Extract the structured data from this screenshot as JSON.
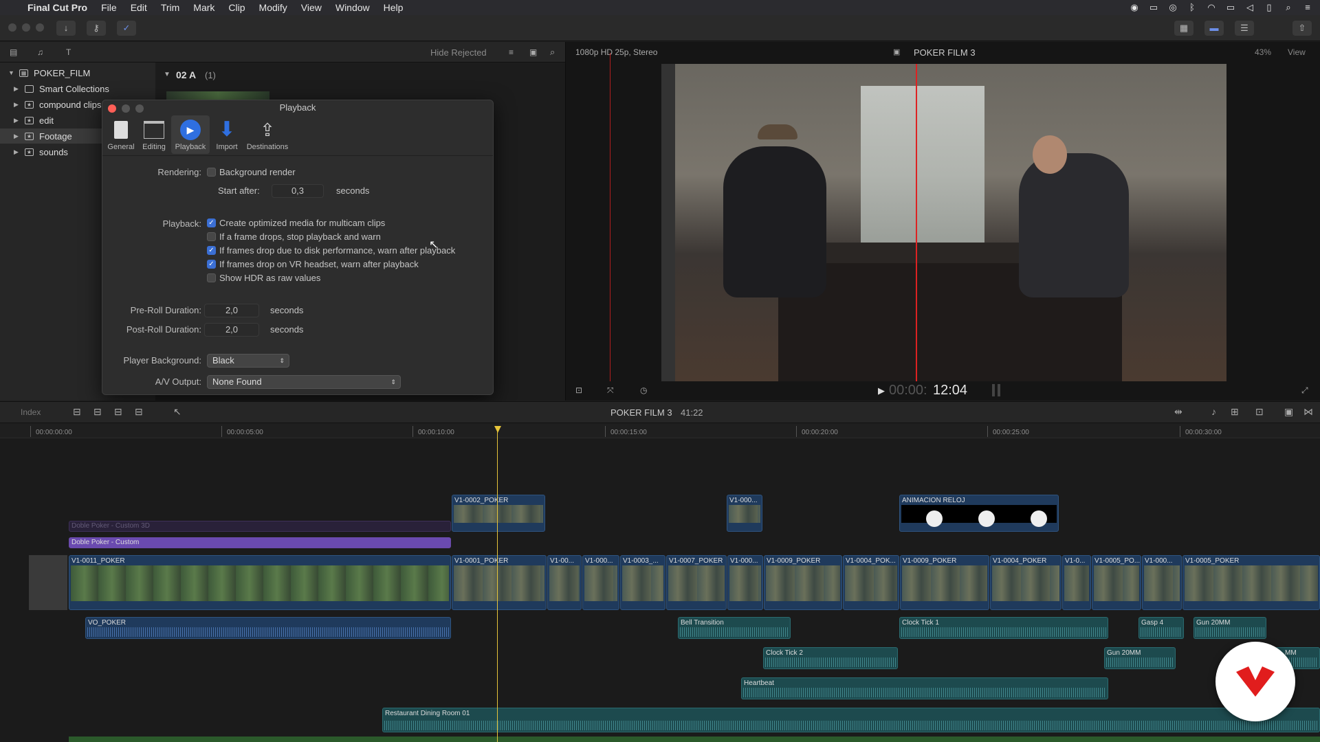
{
  "menubar": {
    "app": "Final Cut Pro",
    "items": [
      "File",
      "Edit",
      "Trim",
      "Mark",
      "Clip",
      "Modify",
      "View",
      "Window",
      "Help"
    ]
  },
  "browser": {
    "filter": "Hide Rejected",
    "library": "POKER_FILM",
    "items": [
      "Smart Collections",
      "compound clips",
      "edit",
      "Footage",
      "sounds"
    ],
    "group_label": "02 A",
    "group_count": "(1)"
  },
  "viewer": {
    "format": "1080p HD 25p, Stereo",
    "project": "POKER FILM 3",
    "zoom": "43%",
    "view_label": "View",
    "timecode_dim": "00:00:",
    "timecode": "12:04"
  },
  "prefs": {
    "title": "Playback",
    "tabs": [
      "General",
      "Editing",
      "Playback",
      "Import",
      "Destinations"
    ],
    "rendering_label": "Rendering:",
    "background_render": "Background render",
    "start_after_label": "Start after:",
    "start_after_value": "0,3",
    "seconds": "seconds",
    "playback_label": "Playback:",
    "options": [
      {
        "label": "Create optimized media for multicam clips",
        "checked": true
      },
      {
        "label": "If a frame drops, stop playback and warn",
        "checked": false
      },
      {
        "label": "If frames drop due to disk performance, warn after playback",
        "checked": true
      },
      {
        "label": "If frames drop on VR headset, warn after playback",
        "checked": true
      },
      {
        "label": "Show HDR as raw values",
        "checked": false
      }
    ],
    "preroll_label": "Pre-Roll Duration:",
    "preroll_value": "2,0",
    "postroll_label": "Post-Roll Duration:",
    "postroll_value": "2,0",
    "bg_label": "Player Background:",
    "bg_value": "Black",
    "av_label": "A/V Output:",
    "av_value": "None Found"
  },
  "timeline": {
    "index_label": "Index",
    "project": "POKER FILM 3",
    "duration": "41:22",
    "ruler": [
      "00:00:00:00",
      "00:00:05:00",
      "00:00:10:00",
      "00:00:15:00",
      "00:00:20:00",
      "00:00:25:00",
      "00:00:30:00"
    ],
    "connected": [
      "V1-0002_POKER",
      "V1-000...",
      "ANIMACION RELOJ"
    ],
    "compound": [
      "Doble Poker - Custom 3D",
      "Doble Poker - Custom"
    ],
    "primary": [
      "V1-0011_POKER",
      "V1-0001_POKER",
      "V1-00...",
      "V1-000...",
      "V1-0003_...",
      "V1-0007_POKER",
      "V1-000...",
      "V1-0009_POKER",
      "V1-0004_POK...",
      "V1-0009_POKER",
      "V1-0004_POKER",
      "V1-0...",
      "V1-0005_PO...",
      "V1-000...",
      "V1-0005_POKER"
    ],
    "audio": [
      "VO_POKER",
      "Bell Transition",
      "Clock Tick 1",
      "Gasp 4",
      "Gun 20MM",
      "Clock Tick 2",
      "Gun 20MM",
      "MM",
      "Heartbeat",
      "Restaurant Dining Room 01"
    ]
  },
  "colors": {
    "accent": "#3b6fd4",
    "playhead": "#e7c53a",
    "brand": "#e11d1d"
  }
}
